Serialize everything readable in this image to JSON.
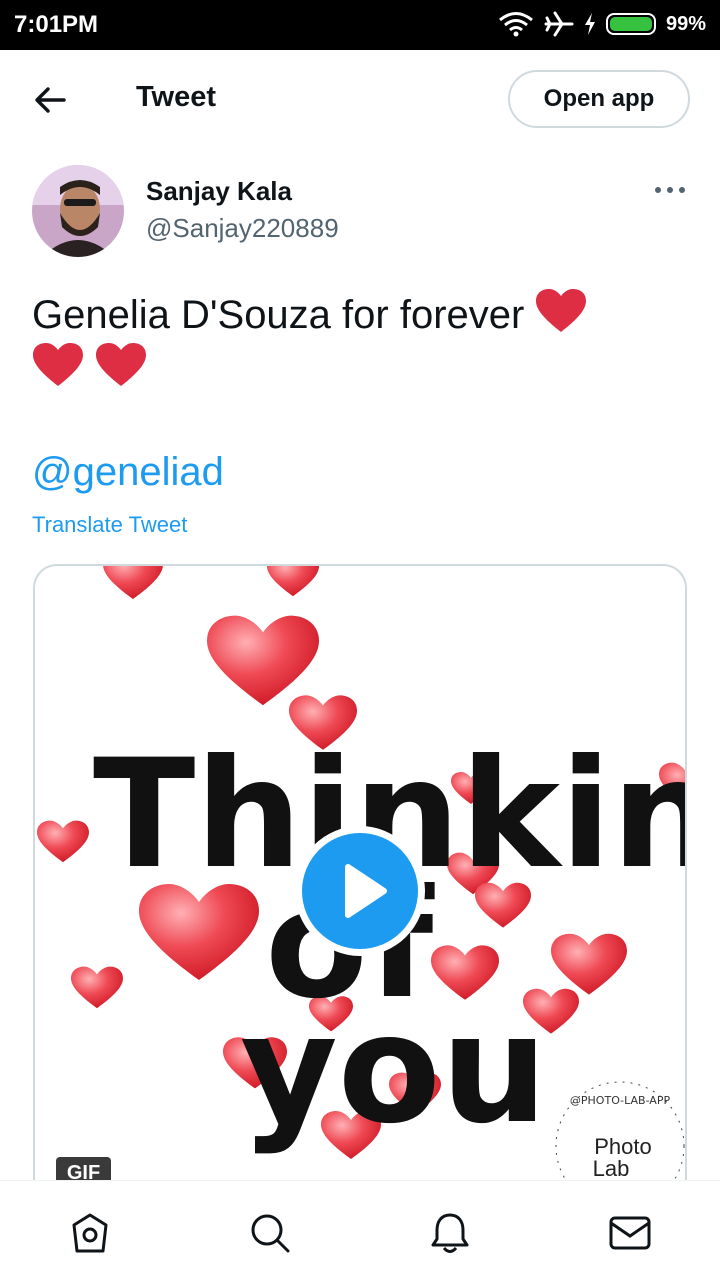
{
  "status_bar": {
    "time": "7:01PM",
    "battery": "99%"
  },
  "header": {
    "title": "Tweet",
    "open_app_label": "Open app"
  },
  "tweet": {
    "author_name": "Sanjay Kala",
    "author_handle": "@Sanjay220889",
    "text": "Genelia D'Souza for forever",
    "mention": "@geneliad",
    "translate_label": "Translate Tweet"
  },
  "media": {
    "type_badge": "GIF",
    "image_text_line1": "Thinking",
    "image_text_line2": "of",
    "image_text_line3": "you",
    "watermark_ring": "@PHOTO-LAB-APP",
    "watermark_line1": "Photo",
    "watermark_line2": "Lab"
  },
  "bottom_nav": {
    "items": [
      "home-icon",
      "search-icon",
      "notifications-icon",
      "messages-icon"
    ]
  },
  "colors": {
    "accent": "#1d9bf0",
    "heart": "#e0243a",
    "text": "#0f1419",
    "secondary": "#536471"
  }
}
